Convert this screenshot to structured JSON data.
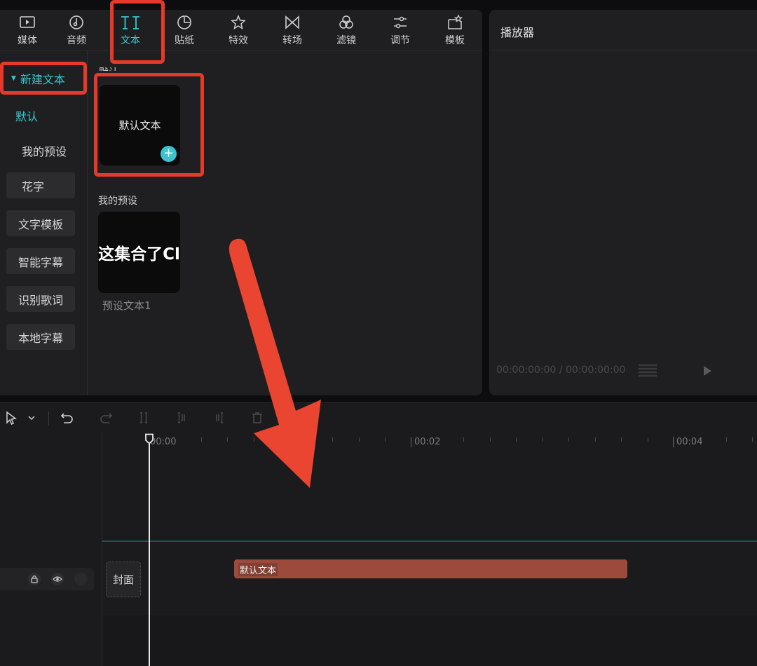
{
  "toolbar_tabs": [
    {
      "label": "媒体",
      "icon": "media-icon"
    },
    {
      "label": "音频",
      "icon": "audio-icon"
    },
    {
      "label": "文本",
      "icon": "text-icon",
      "active": true
    },
    {
      "label": "贴纸",
      "icon": "sticker-icon"
    },
    {
      "label": "特效",
      "icon": "effects-icon"
    },
    {
      "label": "转场",
      "icon": "transition-icon"
    },
    {
      "label": "滤镜",
      "icon": "filter-icon"
    },
    {
      "label": "调节",
      "icon": "adjust-icon"
    },
    {
      "label": "模板",
      "icon": "template-icon"
    }
  ],
  "sidebar": {
    "new_text": "新建文本",
    "default": "默认",
    "my_presets": "我的预设",
    "fancy_text": "花字",
    "text_template": "文字模板",
    "smart_subtitle": "智能字幕",
    "recognize_lyrics": "识别歌词",
    "local_subtitle": "本地字幕"
  },
  "content": {
    "section_default": "默认",
    "default_card_text": "默认文本",
    "section_my_presets": "我的预设",
    "preset_card_text": "这集合了Cl",
    "preset_card_caption": "预设文本1"
  },
  "player": {
    "title": "播放器",
    "timecode": "00:00:00:00 / 00:00:00:00"
  },
  "timeline": {
    "ticks": [
      "00:00",
      "00:02",
      "00:04"
    ],
    "cover_label": "封面",
    "text_clip_label": "默认文本"
  },
  "colors": {
    "accent": "#38c6cf",
    "highlight_box": "#e53a2a",
    "text_clip": "#9b4a3c"
  }
}
